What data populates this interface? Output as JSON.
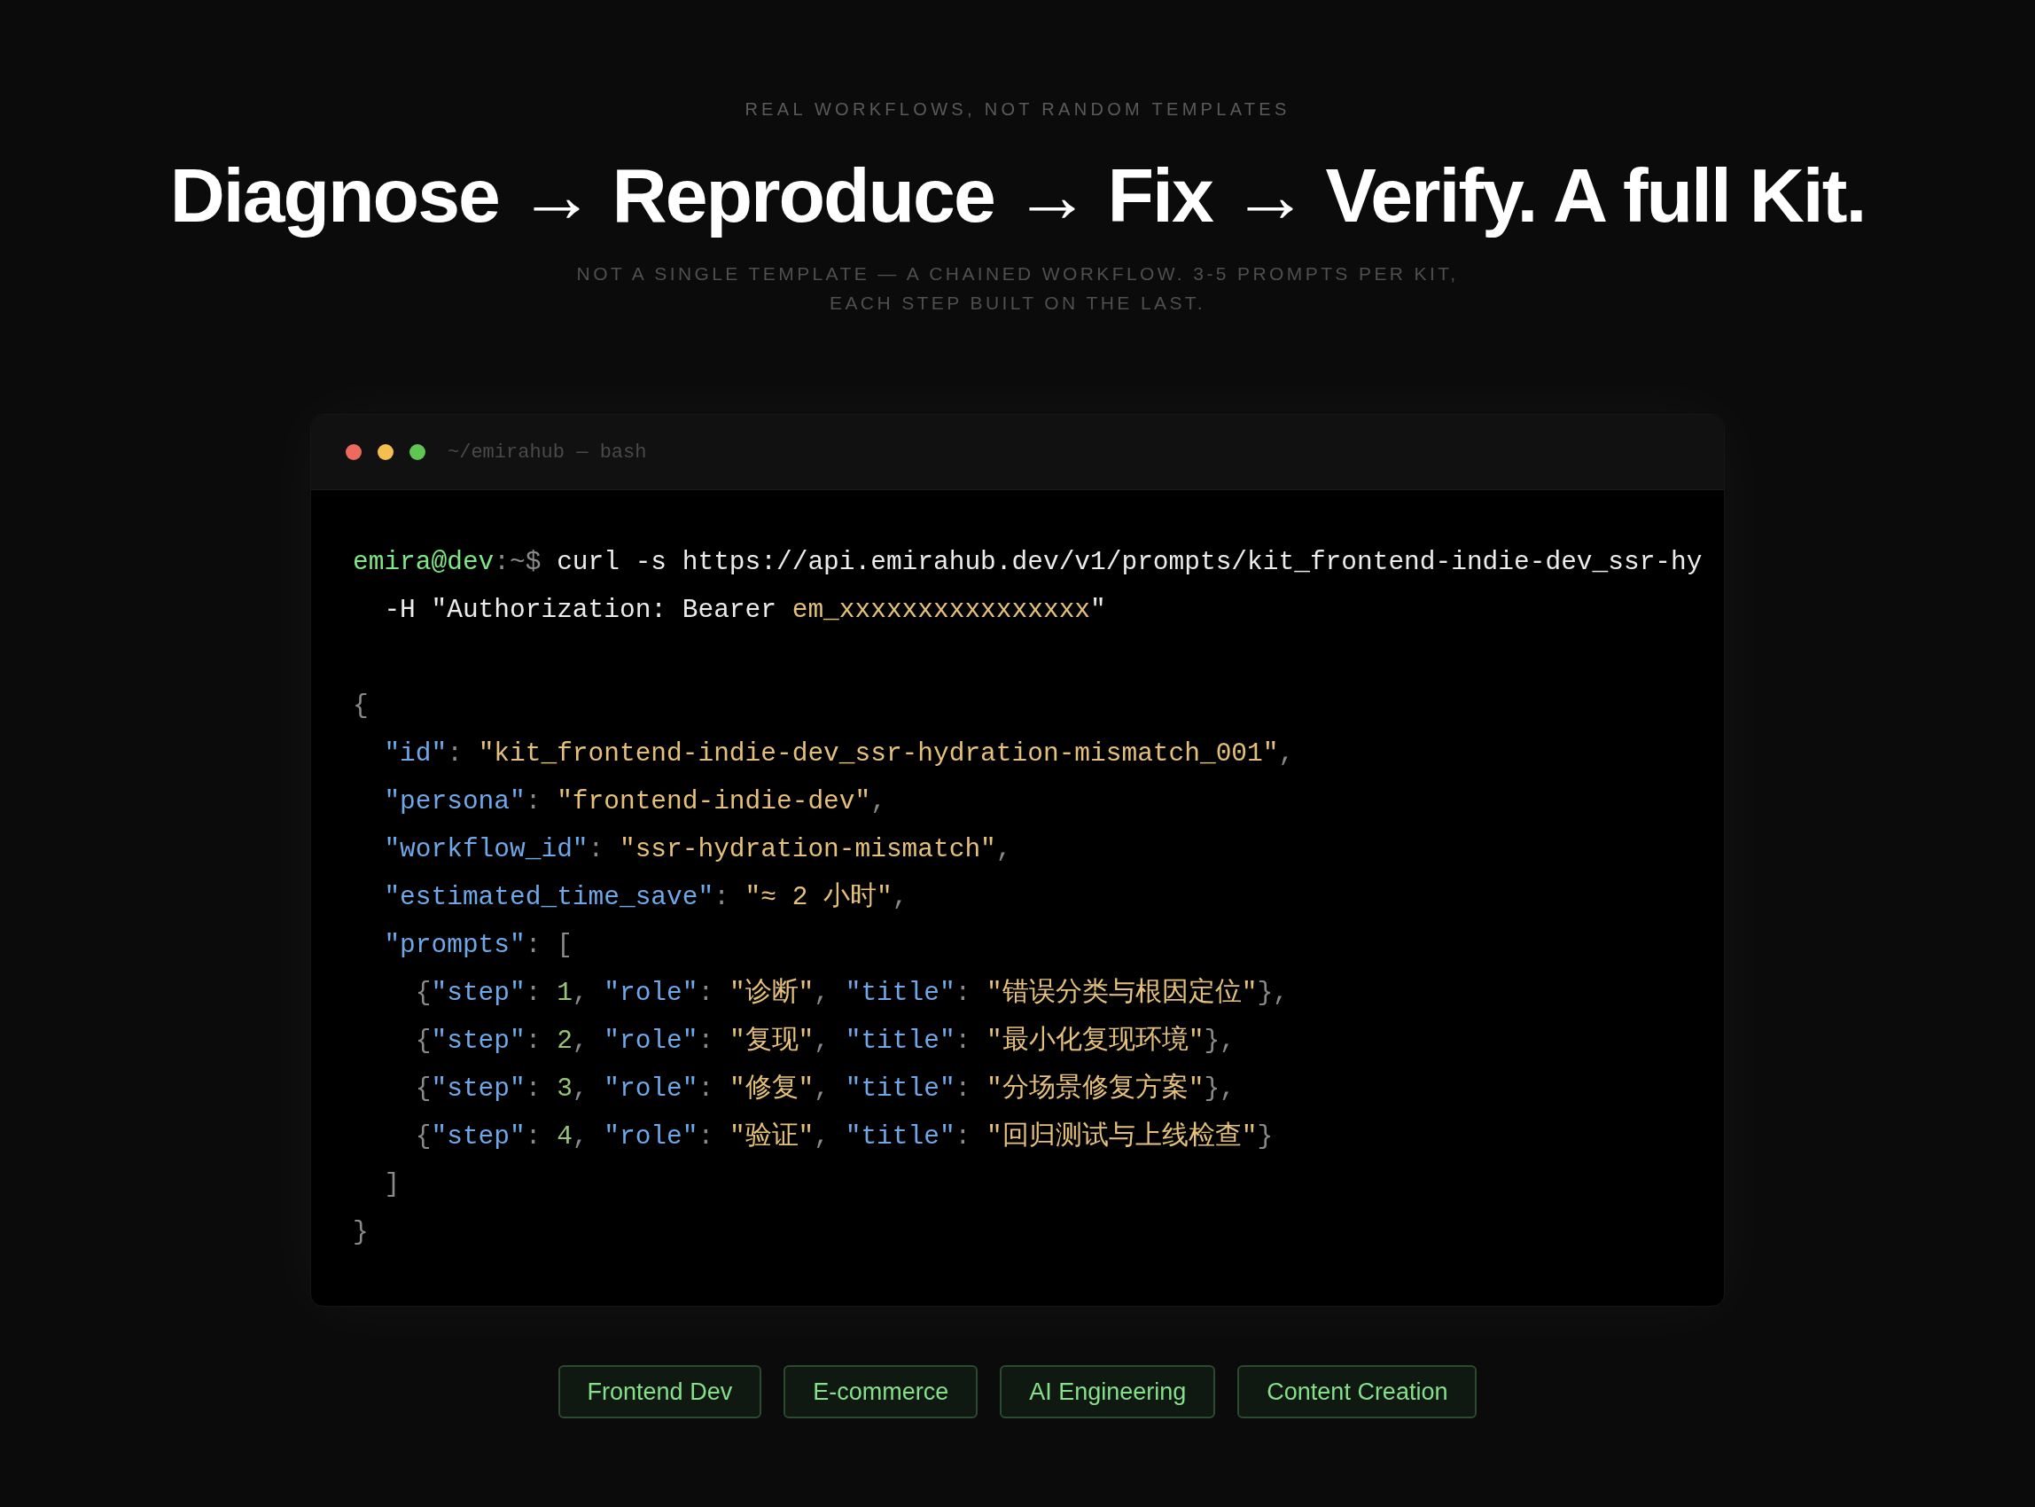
{
  "eyebrow": "REAL WORKFLOWS, NOT RANDOM TEMPLATES",
  "heading": "Diagnose → Reproduce → Fix → Verify. A full Kit.",
  "subtitle_lines": [
    "NOT A SINGLE TEMPLATE — A CHAINED WORKFLOW. 3-5 PROMPTS PER KIT,",
    "EACH STEP BUILT ON THE LAST."
  ],
  "terminal": {
    "title": "~/emirahub — bash",
    "command_lines": [
      [
        {
          "kind": "user",
          "text": "emira@dev"
        },
        {
          "kind": "punct",
          "text": ":~$ "
        },
        {
          "kind": "plain",
          "text": "curl -s https://api.emirahub.dev/v1/prompts/kit_frontend-indie-dev_ssr-hy"
        }
      ],
      [
        {
          "kind": "plain",
          "text": "  -H \"Authorization: Bearer "
        },
        {
          "kind": "string",
          "text": "em_xxxxxxxxxxxxxxxx"
        },
        {
          "kind": "plain",
          "text": "\""
        }
      ]
    ],
    "output_lines": [
      [
        {
          "kind": "punct",
          "text": "{"
        }
      ],
      [
        {
          "kind": "key",
          "text": "  \"id\""
        },
        {
          "kind": "punct",
          "text": ": "
        },
        {
          "kind": "string",
          "text": "\"kit_frontend-indie-dev_ssr-hydration-mismatch_001\""
        },
        {
          "kind": "punct",
          "text": ","
        }
      ],
      [
        {
          "kind": "key",
          "text": "  \"persona\""
        },
        {
          "kind": "punct",
          "text": ": "
        },
        {
          "kind": "string",
          "text": "\"frontend-indie-dev\""
        },
        {
          "kind": "punct",
          "text": ","
        }
      ],
      [
        {
          "kind": "key",
          "text": "  \"workflow_id\""
        },
        {
          "kind": "punct",
          "text": ": "
        },
        {
          "kind": "string",
          "text": "\"ssr-hydration-mismatch\""
        },
        {
          "kind": "punct",
          "text": ","
        }
      ],
      [
        {
          "kind": "key",
          "text": "  \"estimated_time_save\""
        },
        {
          "kind": "punct",
          "text": ": "
        },
        {
          "kind": "string",
          "text": "\"≈ 2 小时\""
        },
        {
          "kind": "punct",
          "text": ","
        }
      ],
      [
        {
          "kind": "key",
          "text": "  \"prompts\""
        },
        {
          "kind": "punct",
          "text": ": ["
        }
      ],
      [
        {
          "kind": "punct",
          "text": "    {"
        },
        {
          "kind": "key",
          "text": "\"step\""
        },
        {
          "kind": "punct",
          "text": ": "
        },
        {
          "kind": "number",
          "text": "1"
        },
        {
          "kind": "punct",
          "text": ", "
        },
        {
          "kind": "key",
          "text": "\"role\""
        },
        {
          "kind": "punct",
          "text": ": "
        },
        {
          "kind": "string",
          "text": "\"诊断\""
        },
        {
          "kind": "punct",
          "text": ", "
        },
        {
          "kind": "key",
          "text": "\"title\""
        },
        {
          "kind": "punct",
          "text": ": "
        },
        {
          "kind": "string",
          "text": "\"错误分类与根因定位\""
        },
        {
          "kind": "punct",
          "text": "},"
        }
      ],
      [
        {
          "kind": "punct",
          "text": "    {"
        },
        {
          "kind": "key",
          "text": "\"step\""
        },
        {
          "kind": "punct",
          "text": ": "
        },
        {
          "kind": "number",
          "text": "2"
        },
        {
          "kind": "punct",
          "text": ", "
        },
        {
          "kind": "key",
          "text": "\"role\""
        },
        {
          "kind": "punct",
          "text": ": "
        },
        {
          "kind": "string",
          "text": "\"复现\""
        },
        {
          "kind": "punct",
          "text": ", "
        },
        {
          "kind": "key",
          "text": "\"title\""
        },
        {
          "kind": "punct",
          "text": ": "
        },
        {
          "kind": "string",
          "text": "\"最小化复现环境\""
        },
        {
          "kind": "punct",
          "text": "},"
        }
      ],
      [
        {
          "kind": "punct",
          "text": "    {"
        },
        {
          "kind": "key",
          "text": "\"step\""
        },
        {
          "kind": "punct",
          "text": ": "
        },
        {
          "kind": "number",
          "text": "3"
        },
        {
          "kind": "punct",
          "text": ", "
        },
        {
          "kind": "key",
          "text": "\"role\""
        },
        {
          "kind": "punct",
          "text": ": "
        },
        {
          "kind": "string",
          "text": "\"修复\""
        },
        {
          "kind": "punct",
          "text": ", "
        },
        {
          "kind": "key",
          "text": "\"title\""
        },
        {
          "kind": "punct",
          "text": ": "
        },
        {
          "kind": "string",
          "text": "\"分场景修复方案\""
        },
        {
          "kind": "punct",
          "text": "},"
        }
      ],
      [
        {
          "kind": "punct",
          "text": "    {"
        },
        {
          "kind": "key",
          "text": "\"step\""
        },
        {
          "kind": "punct",
          "text": ": "
        },
        {
          "kind": "number",
          "text": "4"
        },
        {
          "kind": "punct",
          "text": ", "
        },
        {
          "kind": "key",
          "text": "\"role\""
        },
        {
          "kind": "punct",
          "text": ": "
        },
        {
          "kind": "string",
          "text": "\"验证\""
        },
        {
          "kind": "punct",
          "text": ", "
        },
        {
          "kind": "key",
          "text": "\"title\""
        },
        {
          "kind": "punct",
          "text": ": "
        },
        {
          "kind": "string",
          "text": "\"回归测试与上线检查\""
        },
        {
          "kind": "punct",
          "text": "}"
        }
      ],
      [
        {
          "kind": "punct",
          "text": "  ]"
        }
      ],
      [
        {
          "kind": "punct",
          "text": "}"
        }
      ]
    ]
  },
  "tags": [
    "Frontend Dev",
    "E-commerce",
    "AI Engineering",
    "Content Creation"
  ]
}
